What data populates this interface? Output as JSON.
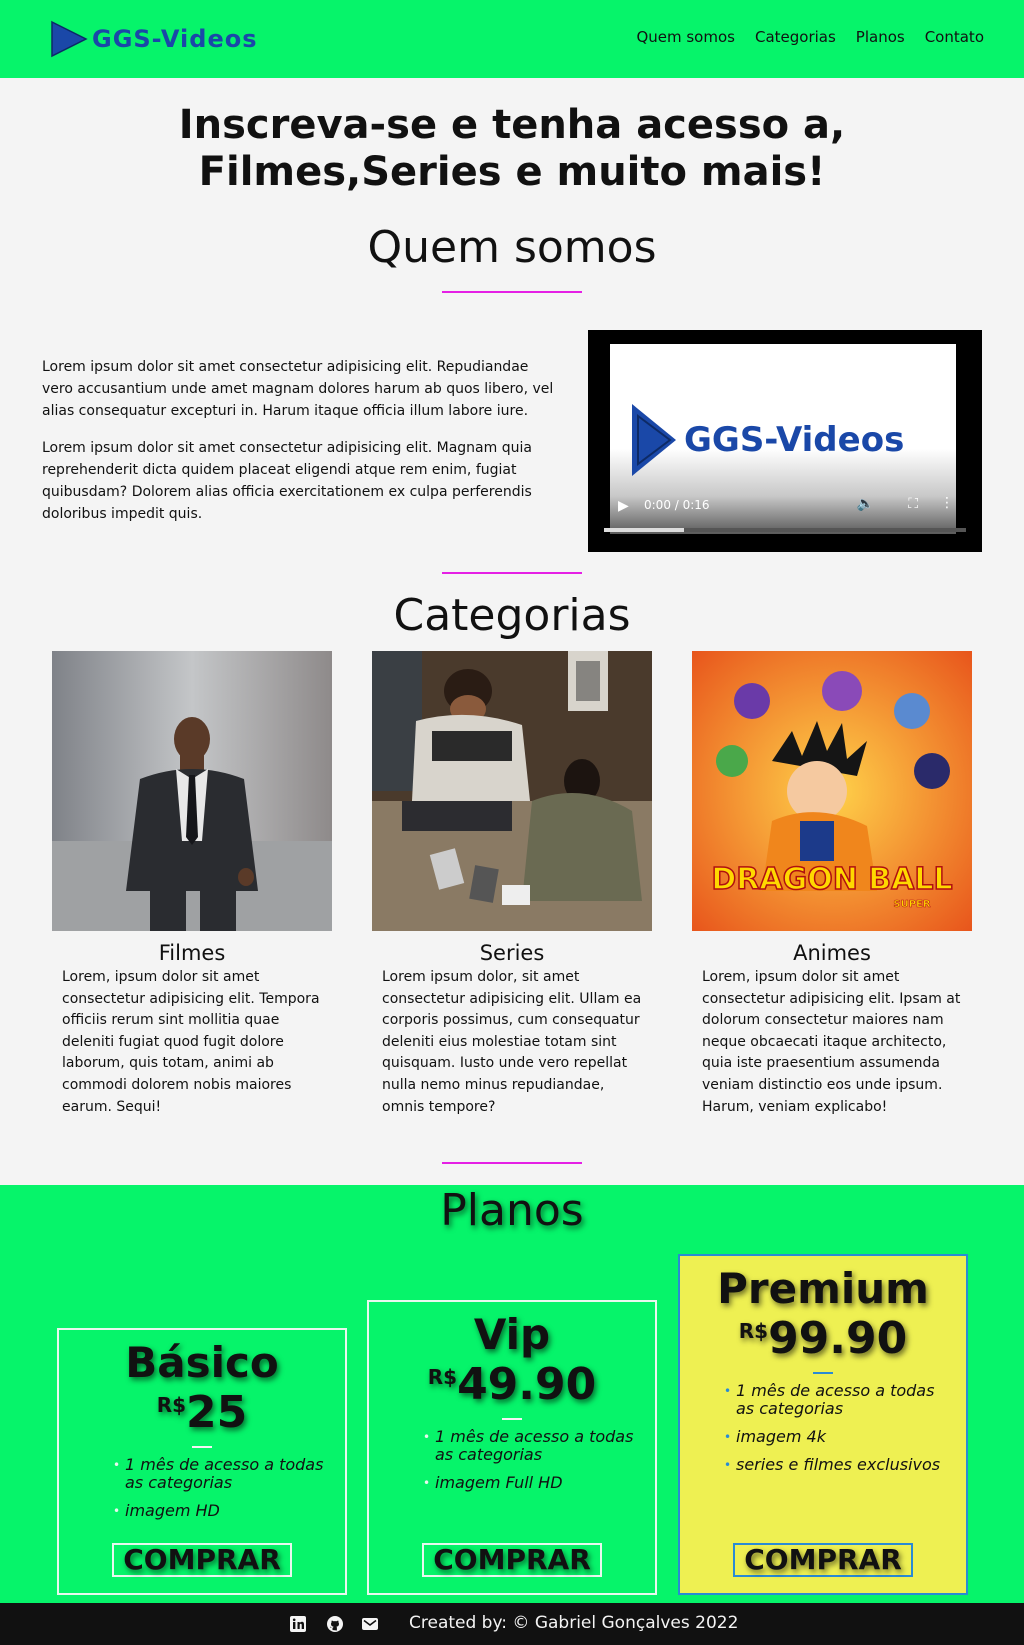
{
  "header": {
    "logo_text": "GGS-Videos",
    "nav": [
      "Quem somos",
      "Categorias",
      "Planos",
      "Contato"
    ]
  },
  "hero": {
    "title_line1": "Inscreva-se e tenha acesso a,",
    "title_line2": "Filmes,Series e muito mais!"
  },
  "about": {
    "title": "Quem somos",
    "paragraphs": [
      "Lorem ipsum dolor sit amet consectetur adipisicing elit. Repudiandae vero accusantium unde amet magnam dolores harum ab quos libero, vel alias consequatur excepturi in. Harum itaque officia illum labore iure.",
      "Lorem ipsum dolor sit amet consectetur adipisicing elit. Magnam quia reprehenderit dicta quidem placeat eligendi atque rem enim, fugiat quibusdam? Dolorem alias officia exercitationem ex culpa perferendis doloribus impedit quis."
    ],
    "video": {
      "logo_text": "GGS-Videos",
      "time": "0:00 / 0:16",
      "progress": 0.22
    }
  },
  "categories": {
    "title": "Categorias",
    "items": [
      {
        "name": "Filmes",
        "desc": "Lorem, ipsum dolor sit amet consectetur adipisicing elit. Tempora officiis rerum sint mollitia quae deleniti fugiat quod fugit dolore laborum, quis totam, animi ab commodi dolorem nobis maiores earum. Sequi!"
      },
      {
        "name": "Series",
        "desc": "Lorem ipsum dolor, sit amet consectetur adipisicing elit. Ullam ea corporis possimus, cum consequatur deleniti eius molestiae totam sint quisquam. Iusto unde vero repellat nulla nemo minus repudiandae, omnis tempore?"
      },
      {
        "name": "Animes",
        "desc": "Lorem, ipsum dolor sit amet consectetur adipisicing elit. Ipsam at dolorum consectetur maiores nam neque obcaecati itaque architecto, quia iste praesentium assumenda veniam distinctio eos unde ipsum. Harum, veniam explicabo!"
      }
    ],
    "anime_art_text": "DRAGON BALL",
    "anime_art_sub": "SUPER"
  },
  "plans": {
    "title": "Planos",
    "currency": "R$",
    "buy_label": "COMPRAR",
    "items": [
      {
        "name": "Básico",
        "price": "25",
        "features": [
          "1 mês de acesso a todas as categorias",
          "imagem HD"
        ]
      },
      {
        "name": "Vip",
        "price": "49.90",
        "features": [
          "1 mês de acesso a todas as categorias",
          "imagem Full HD"
        ]
      },
      {
        "name": "Premium",
        "price": "99.90",
        "features": [
          "1 mês de acesso a todas as categorias",
          "imagem 4k",
          "series e filmes exclusivos"
        ]
      }
    ]
  },
  "footer": {
    "credit": "Created by: © Gabriel Gonçalves 2022",
    "icons": [
      "linkedin-icon",
      "github-icon",
      "email-icon"
    ]
  },
  "colors": {
    "brand_green": "#06f46a",
    "logo_blue": "#1a48a8",
    "divider_magenta": "#e520e5",
    "premium_yellow": "#eef052",
    "premium_border": "#2a8bd4"
  }
}
